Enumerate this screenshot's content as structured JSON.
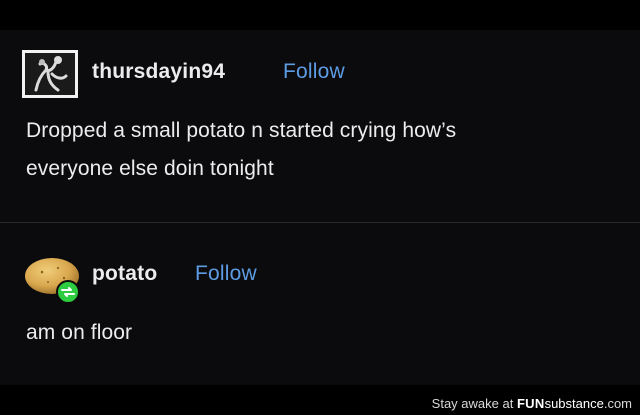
{
  "posts": [
    {
      "username": "thursdayin94",
      "follow_label": "Follow",
      "avatar_icon": "dancer-photo-avatar",
      "text": "Dropped a small potato n started crying how’s\neveryone else doin tonight"
    },
    {
      "username": "potato",
      "follow_label": "Follow",
      "avatar_icon": "potato-avatar",
      "badge_icon": "reblog-icon",
      "text": "am on floor"
    }
  ],
  "footer": {
    "prefix": "Stay awake at ",
    "brand_bold": "FUN",
    "brand_rest": "substance",
    "brand_suffix": ".com"
  },
  "colors": {
    "background": "#0b0b0d",
    "text": "#ececee",
    "link": "#5d9be3",
    "badge": "#2ecc40"
  }
}
